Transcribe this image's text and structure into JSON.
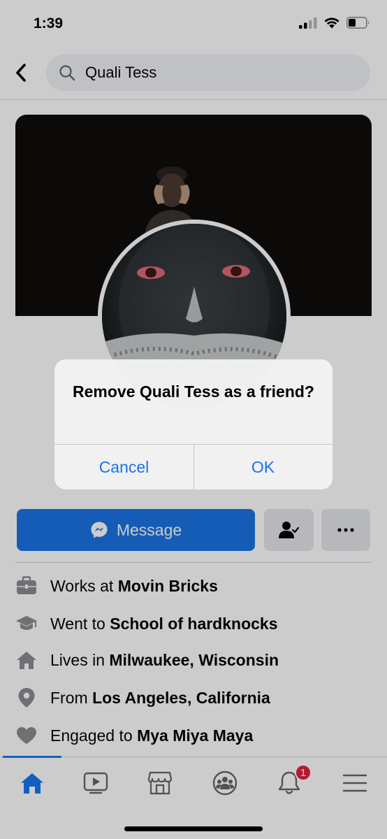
{
  "status_bar": {
    "time": "1:39"
  },
  "search": {
    "query": "Quali Tess"
  },
  "actions": {
    "message_label": "Message"
  },
  "details": [
    {
      "prefix": "Works at",
      "value": "Movin Bricks",
      "icon": "briefcase-icon"
    },
    {
      "prefix": "Went to",
      "value": "School of hardknocks",
      "icon": "graduation-cap-icon"
    },
    {
      "prefix": "Lives in",
      "value": "Milwaukee, Wisconsin",
      "icon": "home-icon"
    },
    {
      "prefix": "From",
      "value": "Los Angeles, California",
      "icon": "location-pin-icon"
    },
    {
      "prefix": "Engaged to",
      "value": "Mya Miya Maya",
      "icon": "heart-icon"
    }
  ],
  "tabbar": {
    "tabs": [
      "home-icon",
      "video-icon",
      "marketplace-icon",
      "groups-icon",
      "notifications-icon",
      "menu-icon"
    ],
    "notification_count": "1"
  },
  "alert": {
    "title": "Remove Quali Tess as a friend?",
    "cancel_label": "Cancel",
    "ok_label": "OK"
  },
  "colors": {
    "accent": "#1b74e4",
    "badge": "#e41e3f",
    "alert_button": "#1a73e8"
  }
}
